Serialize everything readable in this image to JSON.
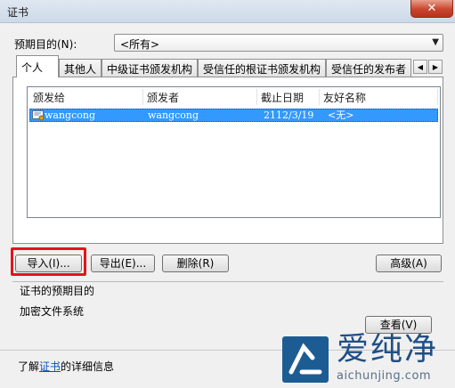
{
  "window": {
    "title": "证书",
    "close_glyph": "✕"
  },
  "purpose": {
    "label": "预期目的(N):",
    "selected": "<所有>"
  },
  "tabs": [
    {
      "label": "个人",
      "active": true
    },
    {
      "label": "其他人",
      "active": false
    },
    {
      "label": "中级证书颁发机构",
      "active": false
    },
    {
      "label": "受信任的根证书颁发机构",
      "active": false
    },
    {
      "label": "受信任的发布者",
      "active": false
    }
  ],
  "tab_scroll": {
    "left": "◀",
    "right": "▶"
  },
  "list": {
    "columns": [
      "颁发给",
      "颁发者",
      "截止日期",
      "友好名称"
    ],
    "rows": [
      {
        "issued_to": "wangcong",
        "issued_by": "wangcong",
        "expiry": "2112/3/19",
        "friendly_name": "<无>",
        "selected": true,
        "icon": "certificate-icon"
      }
    ]
  },
  "buttons": {
    "import": "导入(I)...",
    "export": "导出(E)...",
    "remove": "删除(R)",
    "advanced": "高级(A)",
    "view": "查看(V)"
  },
  "purposes_group": {
    "title": "证书的预期目的",
    "value": "加密文件系统"
  },
  "footer": {
    "prefix": "了解",
    "link": "证书",
    "suffix": "的详细信息"
  },
  "watermark": {
    "brand": "爱纯净",
    "url": "aichunjing.com"
  },
  "colors": {
    "selection": "#3399ff",
    "highlight_box": "#e4141b",
    "link": "#0a4fb8",
    "close_button": "#c9452e"
  }
}
